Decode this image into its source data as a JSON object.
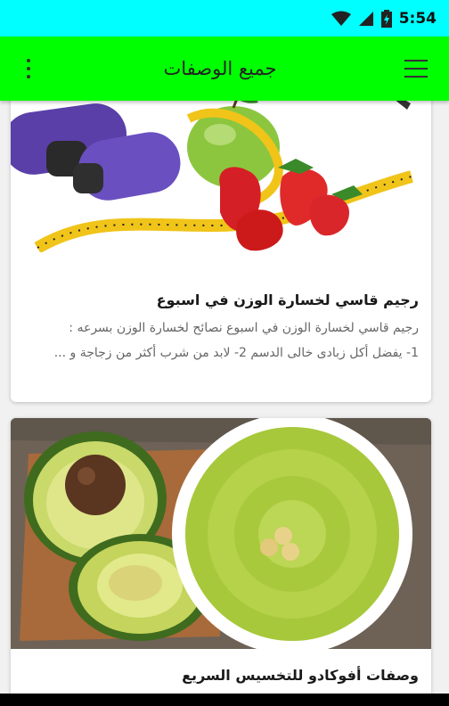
{
  "status_bar": {
    "time": "5:54"
  },
  "app_bar": {
    "title": "جميع الوصفات"
  },
  "recipes": [
    {
      "title": "رجيم قاسي لخسارة الوزن في اسبوع",
      "description_line1": "رجيم قاسي لخسارة الوزن في اسبوع نصائح لخسارة الوزن بسرعه :",
      "description_line2": "1- يفضل أكل زبادى خالى الدسم 2- لابد من شرب أكثر من زجاجة و ..."
    },
    {
      "title": "وصفات أفوكادو للتخسيس السريع"
    }
  ],
  "colors": {
    "status_bar": "#00ffff",
    "app_bar": "#00ff00",
    "background": "#f1f1f1"
  }
}
